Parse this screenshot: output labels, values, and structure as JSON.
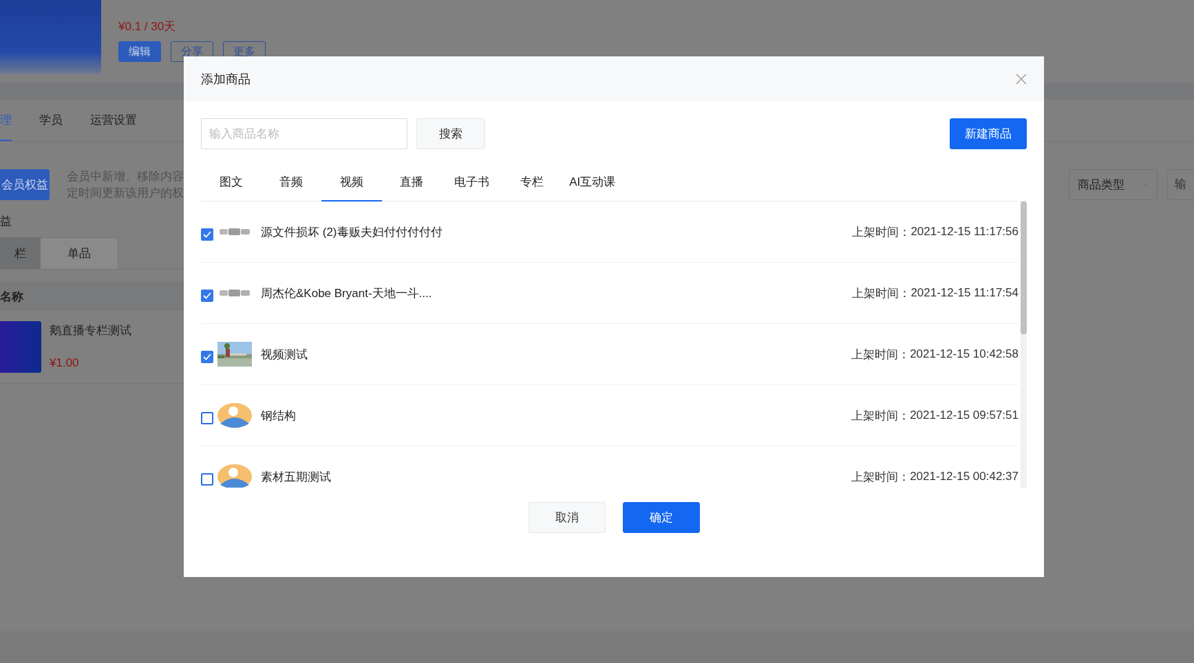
{
  "background_page": {
    "price": "¥0.1 / 30天",
    "actions": [
      {
        "label": "编辑",
        "kind": "primary"
      },
      {
        "label": "分享",
        "kind": "outline"
      },
      {
        "label": "更多",
        "kind": "outline"
      }
    ],
    "tabs": [
      {
        "label": "理",
        "selected": true
      },
      {
        "label": "学员",
        "selected": false
      },
      {
        "label": "运营设置",
        "selected": false
      }
    ],
    "benefit_button": "会员权益",
    "description": [
      "会员中新增、移除内容",
      "定时间更新该用户的权"
    ],
    "section_title": "益",
    "sub_tabs": [
      {
        "label": "栏",
        "selected": false
      },
      {
        "label": "单品",
        "selected": true
      }
    ],
    "filter": {
      "type_select": "商品类型",
      "placeholder": "输"
    },
    "table": {
      "columns": [
        "名称"
      ],
      "rows": [
        {
          "name": "鹅直播专栏测试",
          "price": "¥1.00"
        }
      ]
    }
  },
  "dialog": {
    "title": "添加商品",
    "search": {
      "placeholder": "输入商品名称",
      "button": "搜索"
    },
    "new_button": "新建商品",
    "tabs": [
      {
        "label": "图文",
        "selected": false
      },
      {
        "label": "音频",
        "selected": false
      },
      {
        "label": "视频",
        "selected": true
      },
      {
        "label": "直播",
        "selected": false
      },
      {
        "label": "电子书",
        "selected": false
      },
      {
        "label": "专栏",
        "selected": false
      },
      {
        "label": "AI互动课",
        "selected": false
      }
    ],
    "items": [
      {
        "checked": true,
        "kind": "blurred",
        "title": "源文件损坏 (2)毒贩夫妇付付付付付",
        "time_label": "上架时间：",
        "time": "2021-12-15 11:17:56"
      },
      {
        "checked": true,
        "kind": "blurred",
        "title": "周杰伦&Kobe Bryant-天地一斗....",
        "time_label": "上架时间：",
        "time": "2021-12-15 11:17:54"
      },
      {
        "checked": true,
        "title": "视频测试",
        "time_label": "上架时间：",
        "time": "2021-12-15 10:42:58"
      },
      {
        "checked": false,
        "kind": "avatar",
        "title": "钢结构",
        "time_label": "上架时间：",
        "time": "2021-12-15 09:57:51"
      },
      {
        "checked": false,
        "kind": "avatar",
        "title": "素材五期测试",
        "time_label": "上架时间：",
        "time": "2021-12-15 00:42:37"
      }
    ],
    "buttons": [
      {
        "label": "取消",
        "kind": "secondary"
      },
      {
        "label": "确定",
        "kind": "primary"
      }
    ]
  }
}
